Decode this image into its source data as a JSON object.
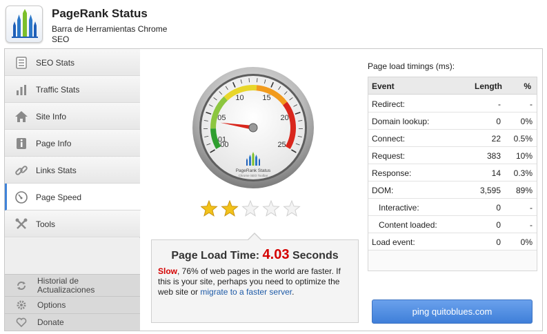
{
  "header": {
    "title": "PageRank Status",
    "subtitle_line1": "Barra de Herramientas Chrome",
    "subtitle_line2": "SEO"
  },
  "sidebar": {
    "items": [
      {
        "label": "SEO Stats",
        "icon": "list-icon"
      },
      {
        "label": "Traffic Stats",
        "icon": "bar-chart-icon"
      },
      {
        "label": "Site Info",
        "icon": "house-icon"
      },
      {
        "label": "Page Info",
        "icon": "info-icon"
      },
      {
        "label": "Links Stats",
        "icon": "link-icon"
      },
      {
        "label": "Page Speed",
        "icon": "speedometer-icon",
        "active": true
      },
      {
        "label": "Tools",
        "icon": "tools-icon"
      }
    ],
    "footer": [
      {
        "label": "Historial de Actualizaciones",
        "icon": "refresh-icon"
      },
      {
        "label": "Options",
        "icon": "gear-icon"
      },
      {
        "label": "Donate",
        "icon": "heart-icon"
      }
    ]
  },
  "gauge": {
    "ticks": [
      "00",
      "01",
      "05",
      "10",
      "15",
      "20",
      "25"
    ],
    "brand": "PageRank Status",
    "brand_sub": "Chrome SEO Toolbar",
    "value": 4.03,
    "max": 25
  },
  "rating": {
    "value": 2,
    "max": 5
  },
  "load_time": {
    "label": "Page Load Time:",
    "value": "4.03",
    "unit": "Seconds",
    "slow_word": "Slow",
    "description": ", 76% of web pages in the world are faster. If this is your site, perhaps you need to optimize the web site or ",
    "link_text": "migrate to a faster server",
    "end": "."
  },
  "timings": {
    "title": "Page load timings (ms):",
    "columns": [
      "Event",
      "Length",
      "%"
    ],
    "rows": [
      {
        "event": "Redirect:",
        "length": "-",
        "pct": "-",
        "indent": false
      },
      {
        "event": "Domain lookup:",
        "length": "0",
        "pct": "0%",
        "indent": false
      },
      {
        "event": "Connect:",
        "length": "22",
        "pct": "0.5%",
        "indent": false
      },
      {
        "event": "Request:",
        "length": "383",
        "pct": "10%",
        "indent": false
      },
      {
        "event": "Response:",
        "length": "14",
        "pct": "0.3%",
        "indent": false
      },
      {
        "event": "DOM:",
        "length": "3,595",
        "pct": "89%",
        "indent": false
      },
      {
        "event": "Interactive:",
        "length": "0",
        "pct": "-",
        "indent": true
      },
      {
        "event": "Content loaded:",
        "length": "0",
        "pct": "-",
        "indent": true
      },
      {
        "event": "Load event:",
        "length": "0",
        "pct": "0%",
        "indent": false
      }
    ]
  },
  "ping_button": {
    "label": "ping quitoblues.com"
  },
  "colors": {
    "accent": "#3f83d9",
    "slow": "#d40000",
    "link": "#1d5aa7"
  }
}
